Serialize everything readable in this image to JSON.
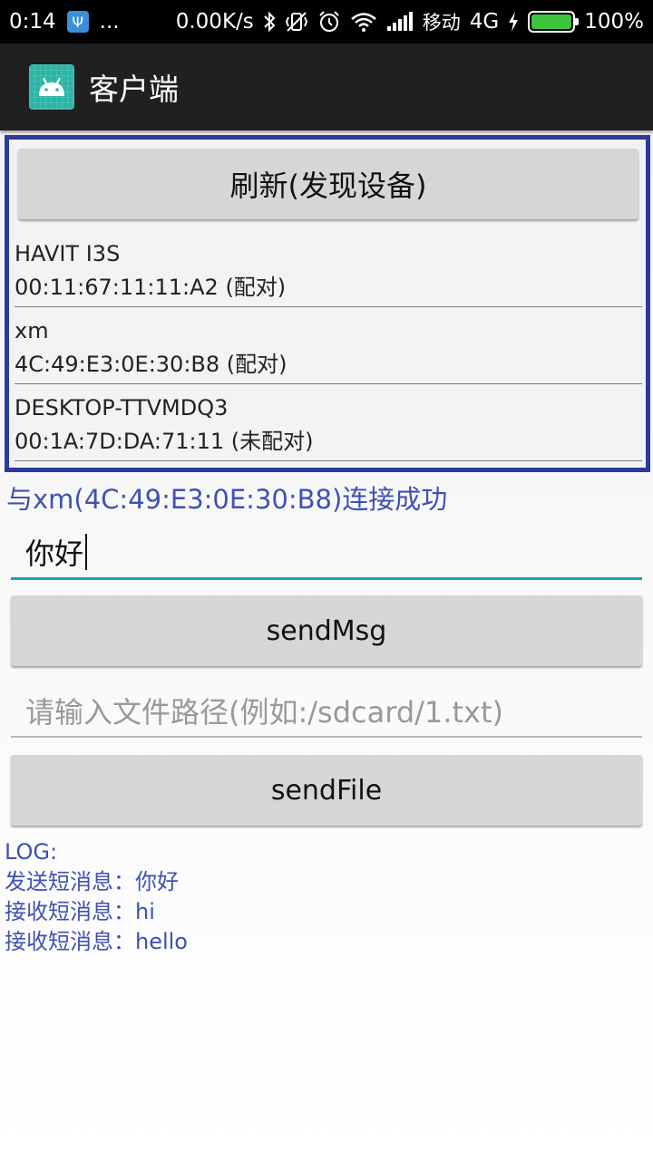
{
  "status_bar": {
    "time": "0:14",
    "dots": "...",
    "speed": "0.00K/s",
    "carrier": "移动",
    "network": "4G",
    "battery_level": 1.0,
    "battery_text": "100%",
    "icons": [
      "usb-icon",
      "bluetooth-icon",
      "vibrate-off-icon",
      "alarm-icon",
      "wifi-icon",
      "signal-icon",
      "charging-icon",
      "battery-icon"
    ]
  },
  "action_bar": {
    "title": "客户端",
    "icon": "android-app-icon",
    "icon_color": "#2bb5a6"
  },
  "devices": {
    "refresh_label": "刷新(发现设备)",
    "items": [
      {
        "name": "HAVIT I3S",
        "address": "00:11:67:11:11:A2 (配对)"
      },
      {
        "name": "xm",
        "address": "4C:49:E3:0E:30:B8 (配对)"
      },
      {
        "name": "DESKTOP-TTVMDQ3",
        "address": "00:1A:7D:DA:71:11 (未配对)"
      }
    ],
    "border_color": "#2c3a9c"
  },
  "connection_status": "与xm(4C:49:E3:0E:30:B8)连接成功",
  "message": {
    "value": "你好",
    "send_label": "sendMsg"
  },
  "file": {
    "placeholder": "请输入文件路径(例如:/sdcard/1.txt)",
    "send_label": "sendFile"
  },
  "log": {
    "title": "LOG:",
    "lines": [
      "发送短消息：你好",
      "接收短消息：hi",
      "接收短消息：hello"
    ]
  },
  "colors": {
    "accent": "#3f51b5",
    "input_focus": "#1e9dc4"
  }
}
